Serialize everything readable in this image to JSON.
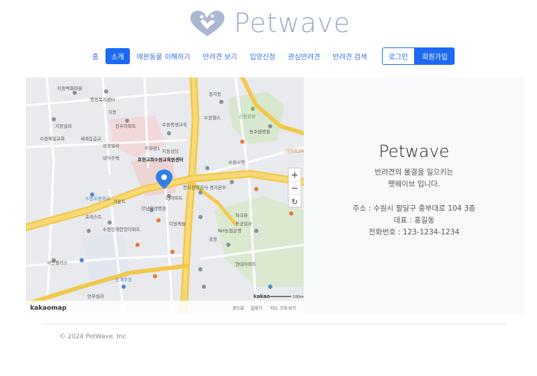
{
  "brand": {
    "name": "Petwave",
    "logo_icon": "heart-paw-logo",
    "color": "#9aa9c8"
  },
  "nav": {
    "items": [
      {
        "label": "홈",
        "active": false
      },
      {
        "label": "소개",
        "active": true
      },
      {
        "label": "애완동물 이해하기",
        "active": false
      },
      {
        "label": "반려견 보기",
        "active": false
      },
      {
        "label": "입양신청",
        "active": false
      },
      {
        "label": "관심반려견",
        "active": false
      },
      {
        "label": "반려견 검색",
        "active": false
      }
    ],
    "login_label": "로그인",
    "join_label": "회원가입",
    "accent": "#1d6af2"
  },
  "map": {
    "logo": "kakaomap",
    "kakao_label": "kakao",
    "scale_label": "100m",
    "zoom_in": "+",
    "zoom_out": "−",
    "refresh": "↻",
    "footer_links": [
      "로드뷰",
      "길찾기",
      "지도 크게 보기"
    ],
    "labels": [
      "지동벽화마을",
      "행정복지센터",
      "지동",
      "원지동",
      "지동빌라",
      "진우아파트",
      "수원제일교회",
      "세례음급교",
      "수원평생교육",
      "수원헬스",
      "성원빌라",
      "주차장1",
      "지동성당",
      "대덕주택",
      "호현교회수원교육원센터",
      "한국전력공사 경기본부",
      "CJ아파트",
      "강남여성병원",
      "디원케슬",
      "포레스트",
      "수원인계한양아파트",
      "가온드",
      "수원초등학교",
      "공원",
      "사인플러스",
      "인계주공",
      "연무빌라",
      "동수원병원",
      "이마트24",
      "현대아파트",
      "파크뷰",
      "NH농협은행",
      "동궁빌라",
      "수원시청",
      "신원공원"
    ]
  },
  "info": {
    "title": "Petwave",
    "slogan_1": "반려견의 물결을 일으키는",
    "slogan_2": "펫웨이브 입니다.",
    "address": "주소 : 수원시 팔달구 중부대로 104 3층",
    "ceo": "대표 : 홍길동",
    "phone": "전화번호 : 123-1234-1234"
  },
  "footer": {
    "copyright": "© 2024 PetWave, Inc"
  }
}
